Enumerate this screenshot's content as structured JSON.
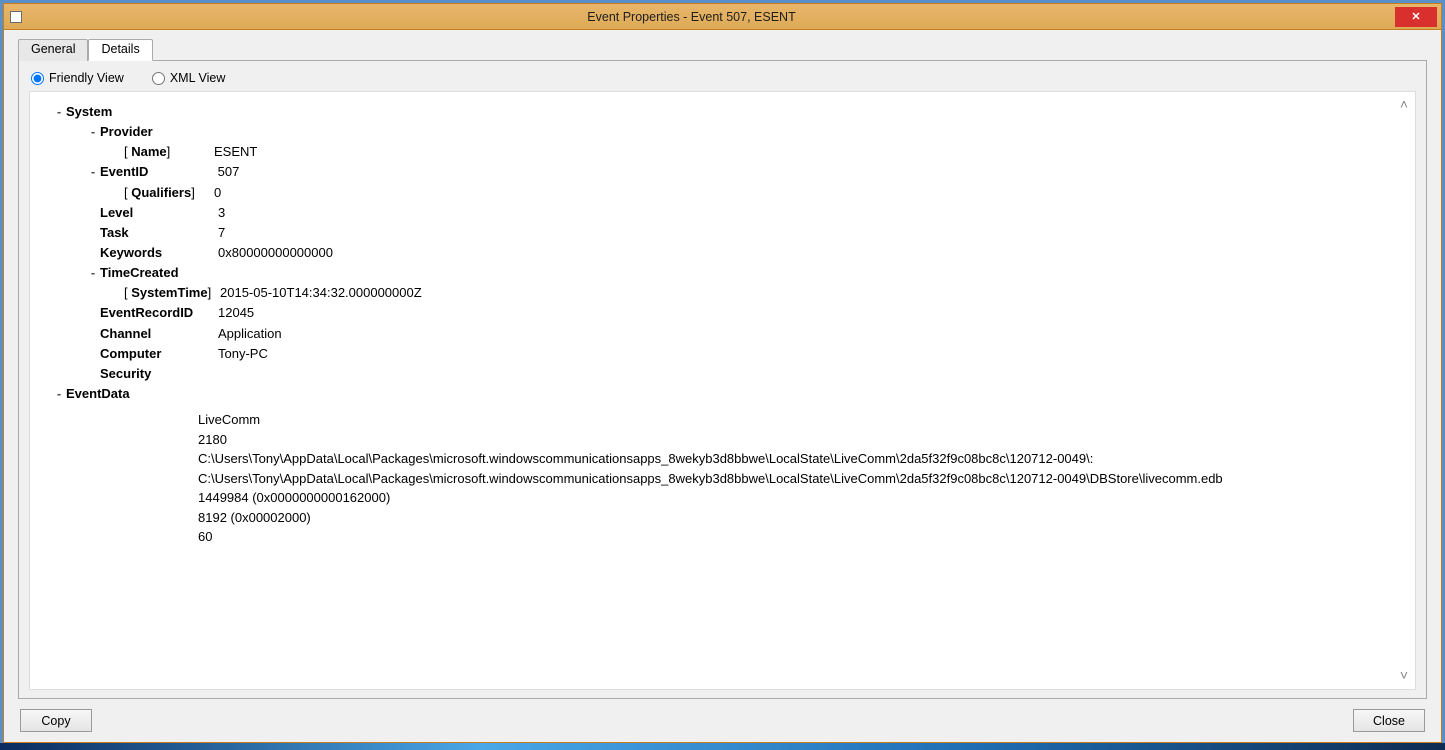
{
  "window": {
    "title": "Event Properties - Event 507, ESENT",
    "close_tooltip": "Close"
  },
  "tabs": {
    "general": "General",
    "details": "Details"
  },
  "viewmodes": {
    "friendly": "Friendly View",
    "xml": "XML View"
  },
  "tree": {
    "system_label": "System",
    "provider_label": "Provider",
    "provider_name_key": "Name",
    "provider_name_val": "ESENT",
    "eventid_label": "EventID",
    "eventid_val": "507",
    "qualifiers_key": "Qualifiers",
    "qualifiers_val": "0",
    "level_key": "Level",
    "level_val": "3",
    "task_key": "Task",
    "task_val": "7",
    "keywords_key": "Keywords",
    "keywords_val": "0x80000000000000",
    "timecreated_label": "TimeCreated",
    "systemtime_key": "SystemTime",
    "systemtime_val": "2015-05-10T14:34:32.000000000Z",
    "eventrecordid_key": "EventRecordID",
    "eventrecordid_val": "12045",
    "channel_key": "Channel",
    "channel_val": "Application",
    "computer_key": "Computer",
    "computer_val": "Tony-PC",
    "security_key": "Security",
    "eventdata_label": "EventData",
    "eventdata_lines": [
      "LiveComm",
      "2180",
      "C:\\Users\\Tony\\AppData\\Local\\Packages\\microsoft.windowscommunicationsapps_8wekyb3d8bbwe\\LocalState\\LiveComm\\2da5f32f9c08bc8c\\120712-0049\\:",
      "C:\\Users\\Tony\\AppData\\Local\\Packages\\microsoft.windowscommunicationsapps_8wekyb3d8bbwe\\LocalState\\LiveComm\\2da5f32f9c08bc8c\\120712-0049\\DBStore\\livecomm.edb",
      "1449984 (0x0000000000162000)",
      "8192 (0x00002000)",
      "60"
    ]
  },
  "buttons": {
    "copy": "Copy",
    "close": "Close",
    "nav_up": "▲",
    "nav_down": "▼"
  }
}
